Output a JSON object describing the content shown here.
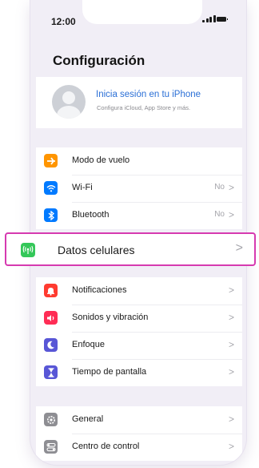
{
  "status_bar": {
    "time": "12:00"
  },
  "screen": {
    "title": "Configuración"
  },
  "profile": {
    "name": "Inicia sesión en tu iPhone",
    "subtitle": "Configura iCloud, App Store y más."
  },
  "group1": [
    {
      "label": "Modo de vuelo",
      "value": "",
      "icon": "airplane-icon",
      "color": "#ff9500"
    },
    {
      "label": "Wi-Fi",
      "value": "No",
      "icon": "wifi-icon",
      "color": "#007aff"
    },
    {
      "label": "Bluetooth",
      "value": "No",
      "icon": "bluetooth-icon",
      "color": "#007aff"
    }
  ],
  "highlight": {
    "label": "Datos celulares",
    "icon": "antenna-icon",
    "color": "#34c759",
    "border_color": "#d63ab0"
  },
  "group2": [
    {
      "label": "Notificaciones",
      "icon": "bell-icon",
      "color": "#ff3b30"
    },
    {
      "label": "Sonidos y vibración",
      "icon": "speaker-icon",
      "color": "#ff2d55"
    },
    {
      "label": "Enfoque",
      "icon": "moon-icon",
      "color": "#5856d6"
    },
    {
      "label": "Tiempo de pantalla",
      "icon": "hourglass-icon",
      "color": "#5856d6"
    }
  ],
  "group3": [
    {
      "label": "General",
      "icon": "gear-icon",
      "color": "#8e8e93"
    },
    {
      "label": "Centro de control",
      "icon": "toggles-icon",
      "color": "#8e8e93"
    }
  ],
  "chevron": ">"
}
